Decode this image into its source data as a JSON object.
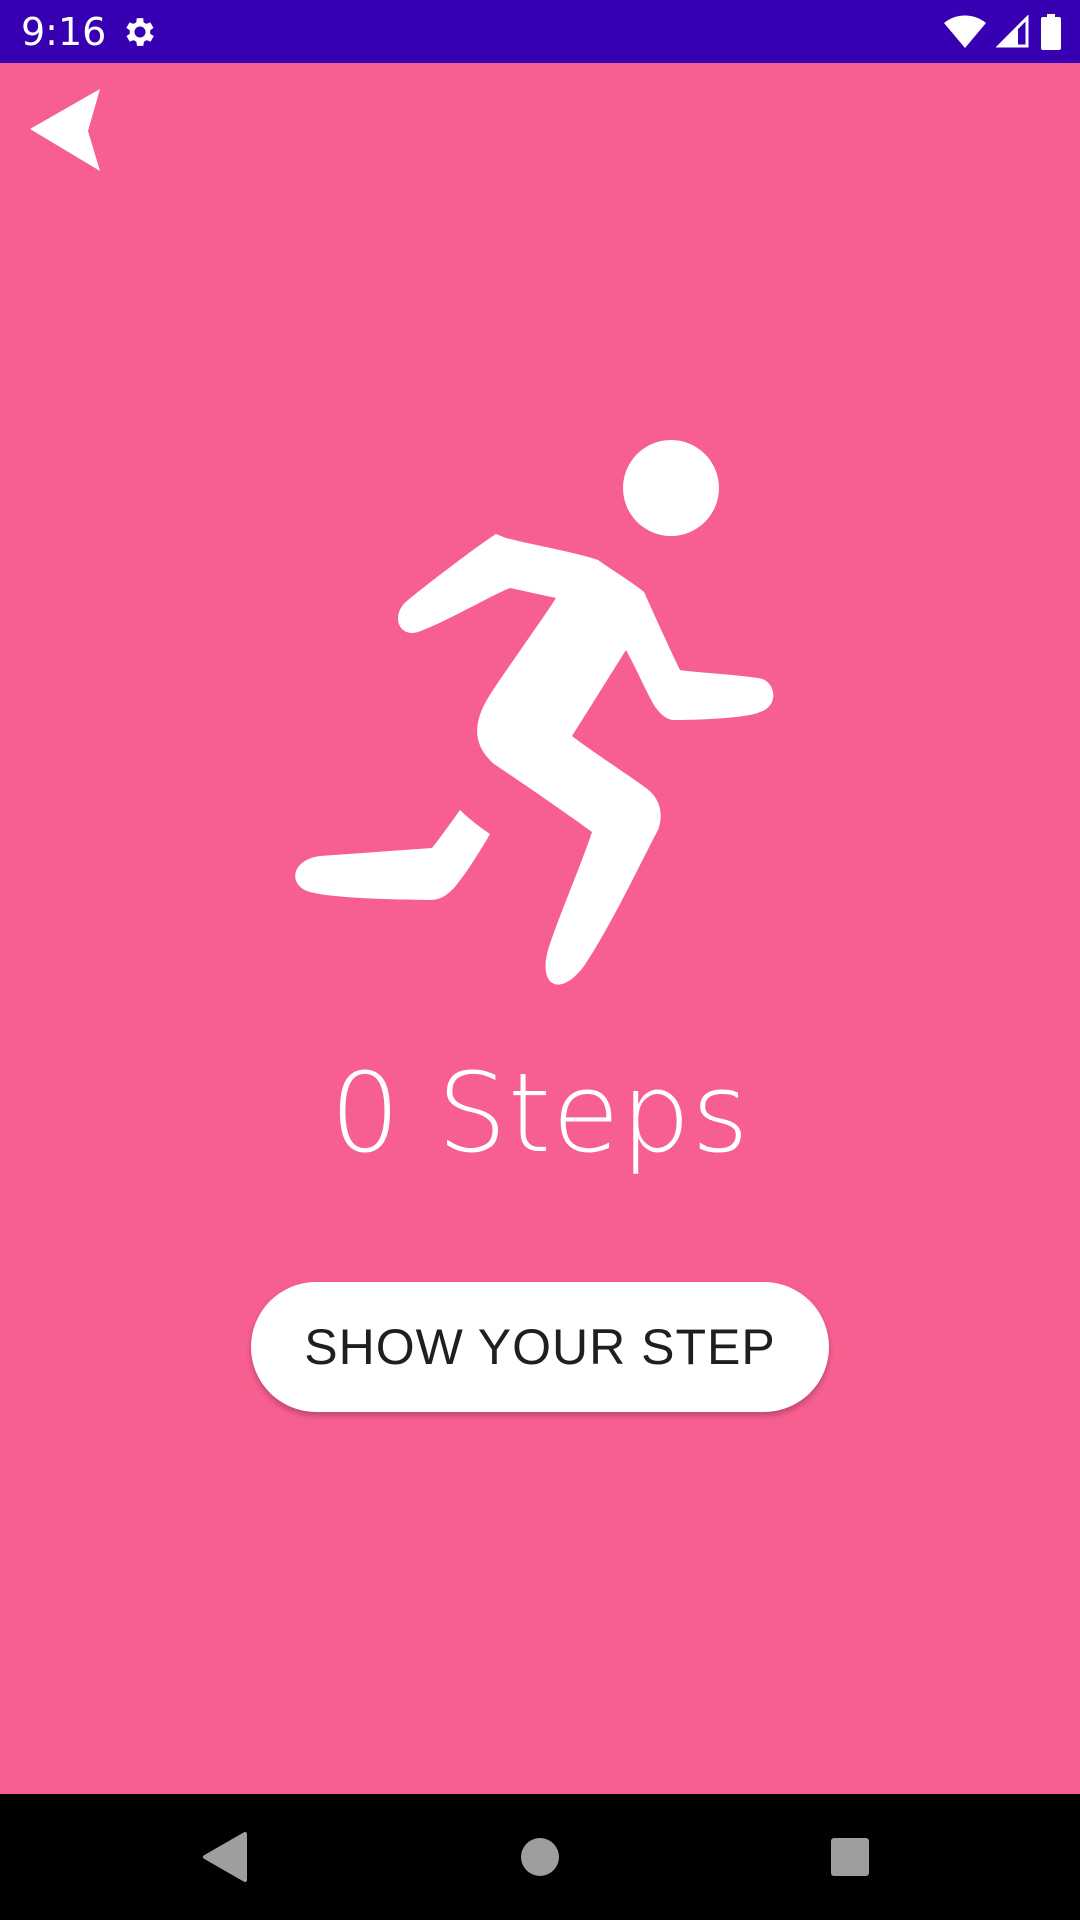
{
  "status_bar": {
    "time": "9:16",
    "background_color": "#3700b3",
    "icons": [
      "settings-gear-icon",
      "wifi-icon",
      "cell-signal-icon",
      "battery-icon"
    ]
  },
  "screen": {
    "background_color": "#f65f8f",
    "back_icon": "back-arrow-icon",
    "hero_icon": "running-person-icon"
  },
  "step_counter": {
    "label": "0 Steps"
  },
  "actions": {
    "show_step_label": "SHOW YOUR STEP"
  },
  "nav_bar": {
    "icons": [
      "nav-back-icon",
      "nav-home-icon",
      "nav-recents-icon"
    ]
  }
}
